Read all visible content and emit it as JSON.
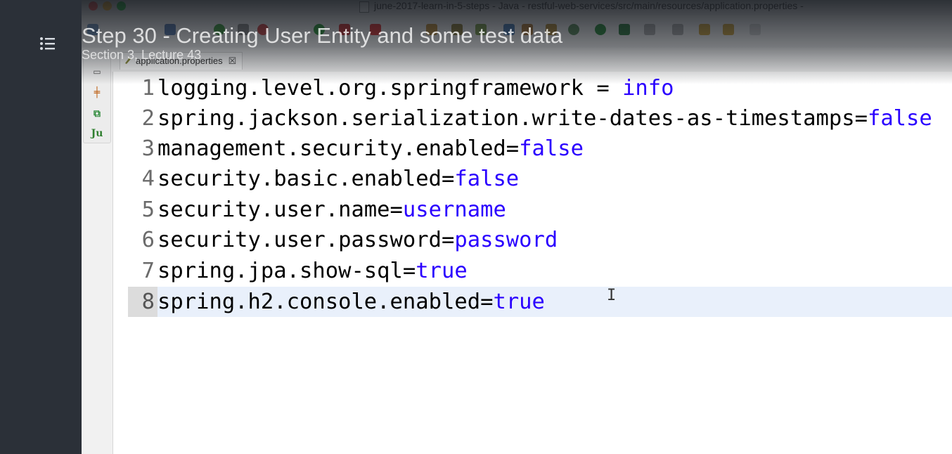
{
  "player": {
    "lecture_title": "Step 30 - Creating User Entity and some test data",
    "lecture_subtitle": "Section 3, Lecture 43",
    "menu_icon": "list-menu-icon"
  },
  "ide": {
    "window_title": "june-2017-learn-in-5-steps - Java - restful-web-services/src/main/resources/application.properties -",
    "tab": {
      "label": "application.properties",
      "close_glyph": "☒"
    },
    "side_tools": [
      "hierarchy-icon",
      "tree-icon",
      "junit-icon"
    ],
    "junit_label": "Ju",
    "code_lines": [
      {
        "num": "1",
        "key": "logging.level.org.springframework",
        "eq": " = ",
        "val": "info"
      },
      {
        "num": "2",
        "key": "spring.jackson.serialization.write-dates-as-timestamps",
        "eq": "=",
        "val": "false"
      },
      {
        "num": "3",
        "key": "management.security.enabled",
        "eq": "=",
        "val": "false"
      },
      {
        "num": "4",
        "key": "security.basic.enabled",
        "eq": "=",
        "val": "false"
      },
      {
        "num": "5",
        "key": "security.user.name",
        "eq": "=",
        "val": "username"
      },
      {
        "num": "6",
        "key": "security.user.password",
        "eq": "=",
        "val": "password"
      },
      {
        "num": "7",
        "key": "spring.jpa.show-sql",
        "eq": "=",
        "val": "true"
      },
      {
        "num": "8",
        "key": "spring.h2.console.enabled",
        "eq": "=",
        "val": "true"
      }
    ],
    "current_line": 8,
    "colors": {
      "value": "#2a00ff",
      "current_line_bg": "#e9f0fb"
    }
  }
}
